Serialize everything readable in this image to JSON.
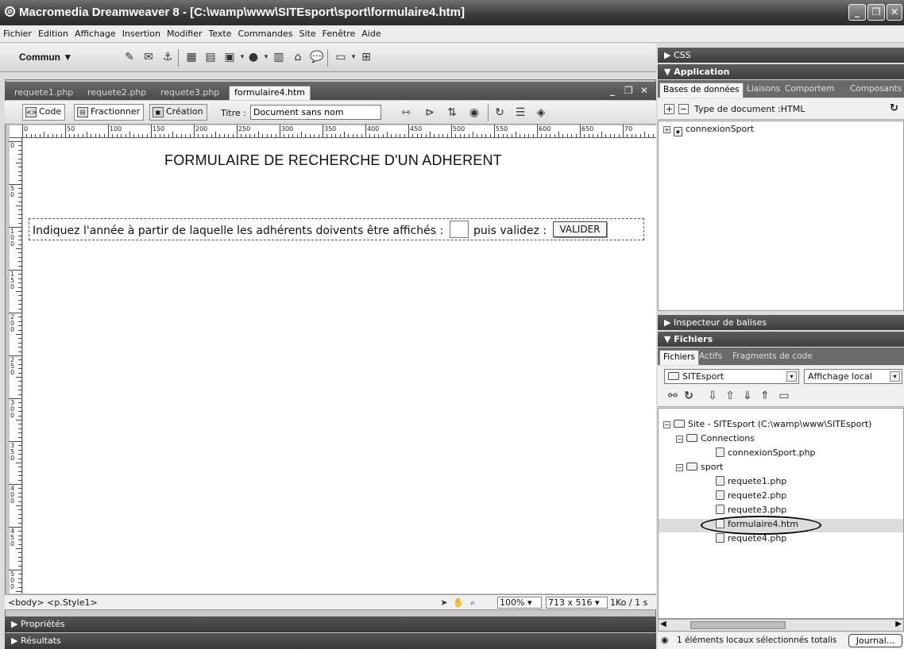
{
  "window": {
    "title": "Macromedia Dreamweaver 8 - [C:\\wamp\\www\\SITEsport\\sport\\formulaire4.htm]"
  },
  "menu": [
    "Fichier",
    "Edition",
    "Affichage",
    "Insertion",
    "Modifier",
    "Texte",
    "Commandes",
    "Site",
    "Fenêtre",
    "Aide"
  ],
  "insertbar": {
    "category": "Commun ▼"
  },
  "doc_tabs": [
    "requete1.php",
    "requete2.php",
    "requete3.php",
    "formulaire4.htm"
  ],
  "doc_toolbar": {
    "code": "Code",
    "split": "Fractionner",
    "design": "Création",
    "title_label": "Titre :",
    "title_value": "Document sans nom"
  },
  "ruler": {
    "h": [
      "0",
      "50",
      "100",
      "150",
      "200",
      "250",
      "300",
      "350",
      "400",
      "450",
      "500",
      "550",
      "600",
      "650",
      "70"
    ],
    "v": [
      "0",
      "50",
      "100",
      "150",
      "200",
      "250",
      "300",
      "350",
      "400",
      "450",
      "500",
      "5"
    ]
  },
  "page": {
    "heading": "FORMULAIRE DE RECHERCHE D'UN ADHERENT",
    "prompt": "Indiquez l'année à partir de laquelle les adhérents doivents être affichés :",
    "after": "puis validez :",
    "button": "VALIDER"
  },
  "statusbar": {
    "tags": "<body> <p.Style1>",
    "zoom": "100%",
    "size": "713 x 516",
    "download": "1Ko / 1 s"
  },
  "bottom_panels": [
    "Propriétés",
    "Résultats"
  ],
  "right": {
    "css": "CSS",
    "application": "Application",
    "app_tabs": [
      "Bases de données",
      "Liaisons",
      "Comportem",
      "Composants"
    ],
    "doc_type": "Type de document :HTML",
    "db_item": "connexionSport",
    "tag_inspector": "Inspecteur de balises",
    "files_header": "Fichiers",
    "files_tabs": [
      "Fichiers",
      "Actifs",
      "Fragments de code"
    ],
    "site_select": "SITEsport",
    "view_select": "Affichage local",
    "tree": {
      "root": "Site - SITEsport (C:\\wamp\\www\\SITEsport)",
      "connections": "Connections",
      "conn_file": "connexionSport.php",
      "sport": "sport",
      "files": [
        "requete1.php",
        "requete2.php",
        "requete3.php",
        "formulaire4.htm",
        "requete4.php"
      ]
    },
    "status": "1 éléments locaux sélectionnés totalis",
    "journal": "Journal..."
  }
}
